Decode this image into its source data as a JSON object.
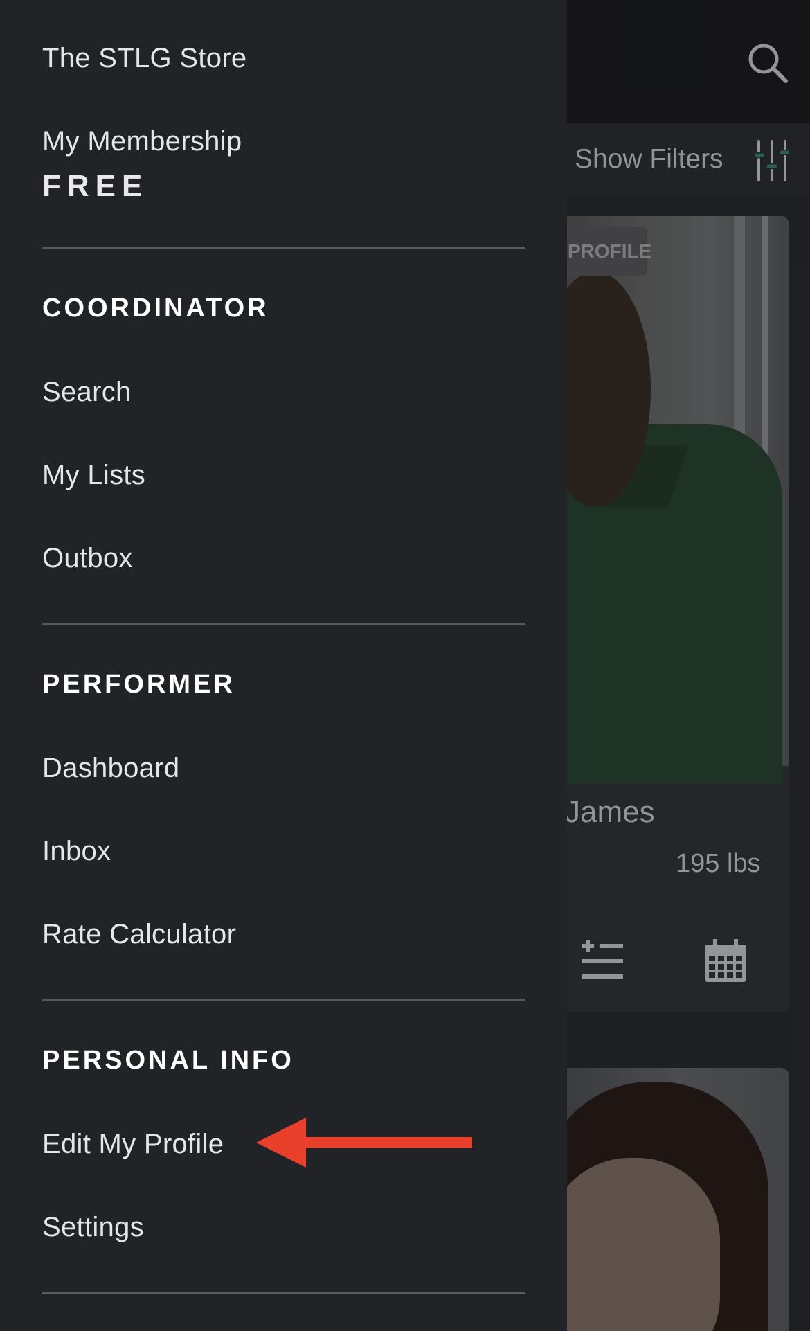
{
  "background": {
    "show_filters_label": "Show Filters",
    "card1": {
      "badge": "PROFILE",
      "name": "James",
      "weight": "195 lbs"
    }
  },
  "drawer": {
    "store_link": "The STLG Store",
    "membership_label": "My Membership",
    "membership_tier": "FREE",
    "sections": {
      "coordinator": {
        "heading": "COORDINATOR",
        "items": [
          "Search",
          "My Lists",
          "Outbox"
        ]
      },
      "performer": {
        "heading": "PERFORMER",
        "items": [
          "Dashboard",
          "Inbox",
          "Rate Calculator"
        ]
      },
      "personal_info": {
        "heading": "PERSONAL INFO",
        "items": [
          "Edit My Profile",
          "Settings"
        ]
      }
    }
  },
  "annotation": {
    "arrow_color": "#e8402b",
    "points_to": "Edit My Profile"
  },
  "colors": {
    "drawer_bg": "#222327",
    "divider": "#5a5b5f",
    "text": "#e6e6e8"
  }
}
